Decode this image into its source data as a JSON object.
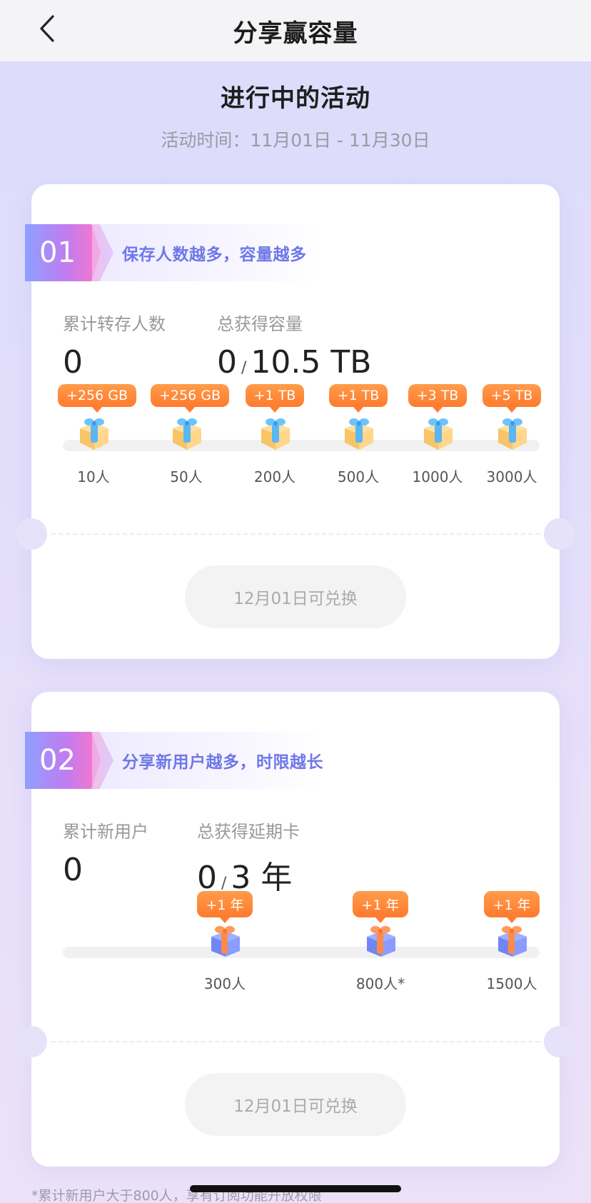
{
  "nav": {
    "title": "分享赢容量"
  },
  "header": {
    "title": "进行中的活动",
    "period": "活动时间：11月01日 - 11月30日"
  },
  "activities": [
    {
      "index": "01",
      "heading": "保存人数越多，容量越多",
      "stat1_label": "累计转存人数",
      "stat1_value": "0",
      "stat2_label": "总获得容量",
      "stat2_value": "0",
      "stat2_slash": "/",
      "stat2_total": "10.5 TB",
      "milestones": [
        {
          "reward": "+256 GB",
          "people": "10人",
          "icon": "gift-box-icon"
        },
        {
          "reward": "+256 GB",
          "people": "50人",
          "icon": "gift-box-icon"
        },
        {
          "reward": "+1 TB",
          "people": "200人",
          "icon": "gift-box-icon"
        },
        {
          "reward": "+1 TB",
          "people": "500人",
          "icon": "gift-box-icon"
        },
        {
          "reward": "+3 TB",
          "people": "1000人",
          "icon": "gift-box-icon"
        },
        {
          "reward": "+5 TB",
          "people": "3000人",
          "icon": "gift-box-icon"
        }
      ],
      "progress": 0,
      "redeem_label": "12月01日可兑换"
    },
    {
      "index": "02",
      "heading": "分享新用户越多，时限越长",
      "stat1_label": "累计新用户",
      "stat1_value": "0",
      "stat2_label": "总获得延期卡",
      "stat2_value": "0",
      "stat2_slash": "/",
      "stat2_total": "3 年",
      "milestones": [
        {
          "reward": "+1 年",
          "people": "300人",
          "icon": "gift-box-icon"
        },
        {
          "reward": "+1 年",
          "people": "800人*",
          "icon": "gift-box-icon"
        },
        {
          "reward": "+1 年",
          "people": "1500人",
          "icon": "gift-box-icon"
        }
      ],
      "progress": 0,
      "redeem_label": "12月01日可兑换"
    }
  ],
  "footnote": "*累计新用户大于800人，享有订阅功能开放权限",
  "colors": {
    "accent_orange": "#ff7a2e",
    "badge_text": "#6e78e8",
    "gradient_start": "#8ea0ff",
    "gradient_end": "#ff77c8"
  }
}
